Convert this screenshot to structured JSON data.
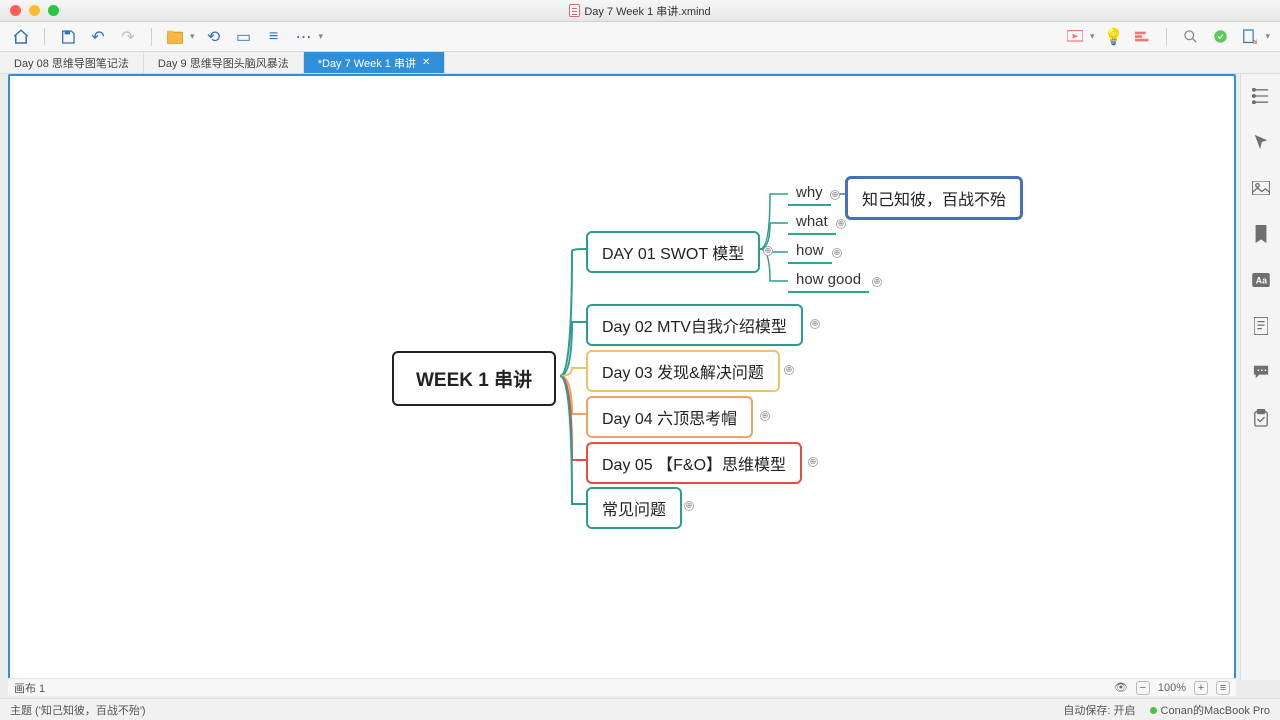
{
  "window": {
    "title": "Day 7 Week 1 串讲.xmind"
  },
  "tabs": [
    {
      "label": "Day 08 思维导图笔记法",
      "active": false
    },
    {
      "label": "Day 9 思维导图头脑风暴法",
      "active": false
    },
    {
      "label": "*Day 7 Week 1 串讲",
      "active": true
    }
  ],
  "mindmap": {
    "root": "WEEK 1 串讲",
    "children": [
      {
        "label": "DAY 01 SWOT 模型",
        "color": "#2a9d8f",
        "subs": [
          "why",
          "what",
          "how",
          "how good"
        ],
        "why_detail": "知己知彼，百战不殆"
      },
      {
        "label": "Day 02 MTV自我介绍模型",
        "color": "#2a9d8f"
      },
      {
        "label": "Day 03 发现&解决问题",
        "color": "#e9c46a"
      },
      {
        "label": "Day 04 六顶思考帽",
        "color": "#f4a261"
      },
      {
        "label": "Day 05 【F&O】思维模型",
        "color": "#e74c3c"
      },
      {
        "label": "常见问题",
        "color": "#2a9d8f"
      }
    ]
  },
  "canvas_tab": "画布 1",
  "zoom": "100%",
  "status": {
    "left": "主题 ('知己知彼，百战不殆')",
    "autosave": "自动保存: 开启",
    "device": "Conan的MacBook Pro"
  }
}
